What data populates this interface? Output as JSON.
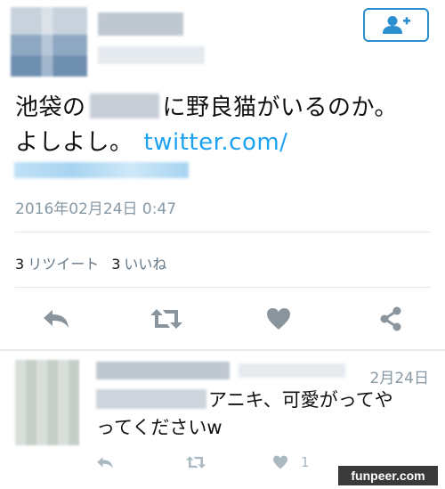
{
  "tweet": {
    "text_part1": "池袋の",
    "text_part2": "に野良猫がいるのか。",
    "text_line2": "よしよし。",
    "link": "twitter.com/",
    "timestamp": "2016年02月24日 0:47"
  },
  "stats": {
    "retweets_count": "3",
    "retweets_label": "リツイート",
    "likes_count": "3",
    "likes_label": "いいね"
  },
  "reply": {
    "date": "2月24日",
    "text_line1": "アニキ、可愛がってや",
    "text_line2": "ってくださいw",
    "like_count": "1"
  },
  "watermark": "funpeer.com",
  "colors": {
    "accent": "#1da1f2",
    "follow_border": "#2a8ecf",
    "icon_gray": "#8a949c",
    "muted": "#8899a6"
  },
  "icons": [
    "follow-icon",
    "reply-icon",
    "retweet-icon",
    "heart-icon",
    "share-icon"
  ]
}
